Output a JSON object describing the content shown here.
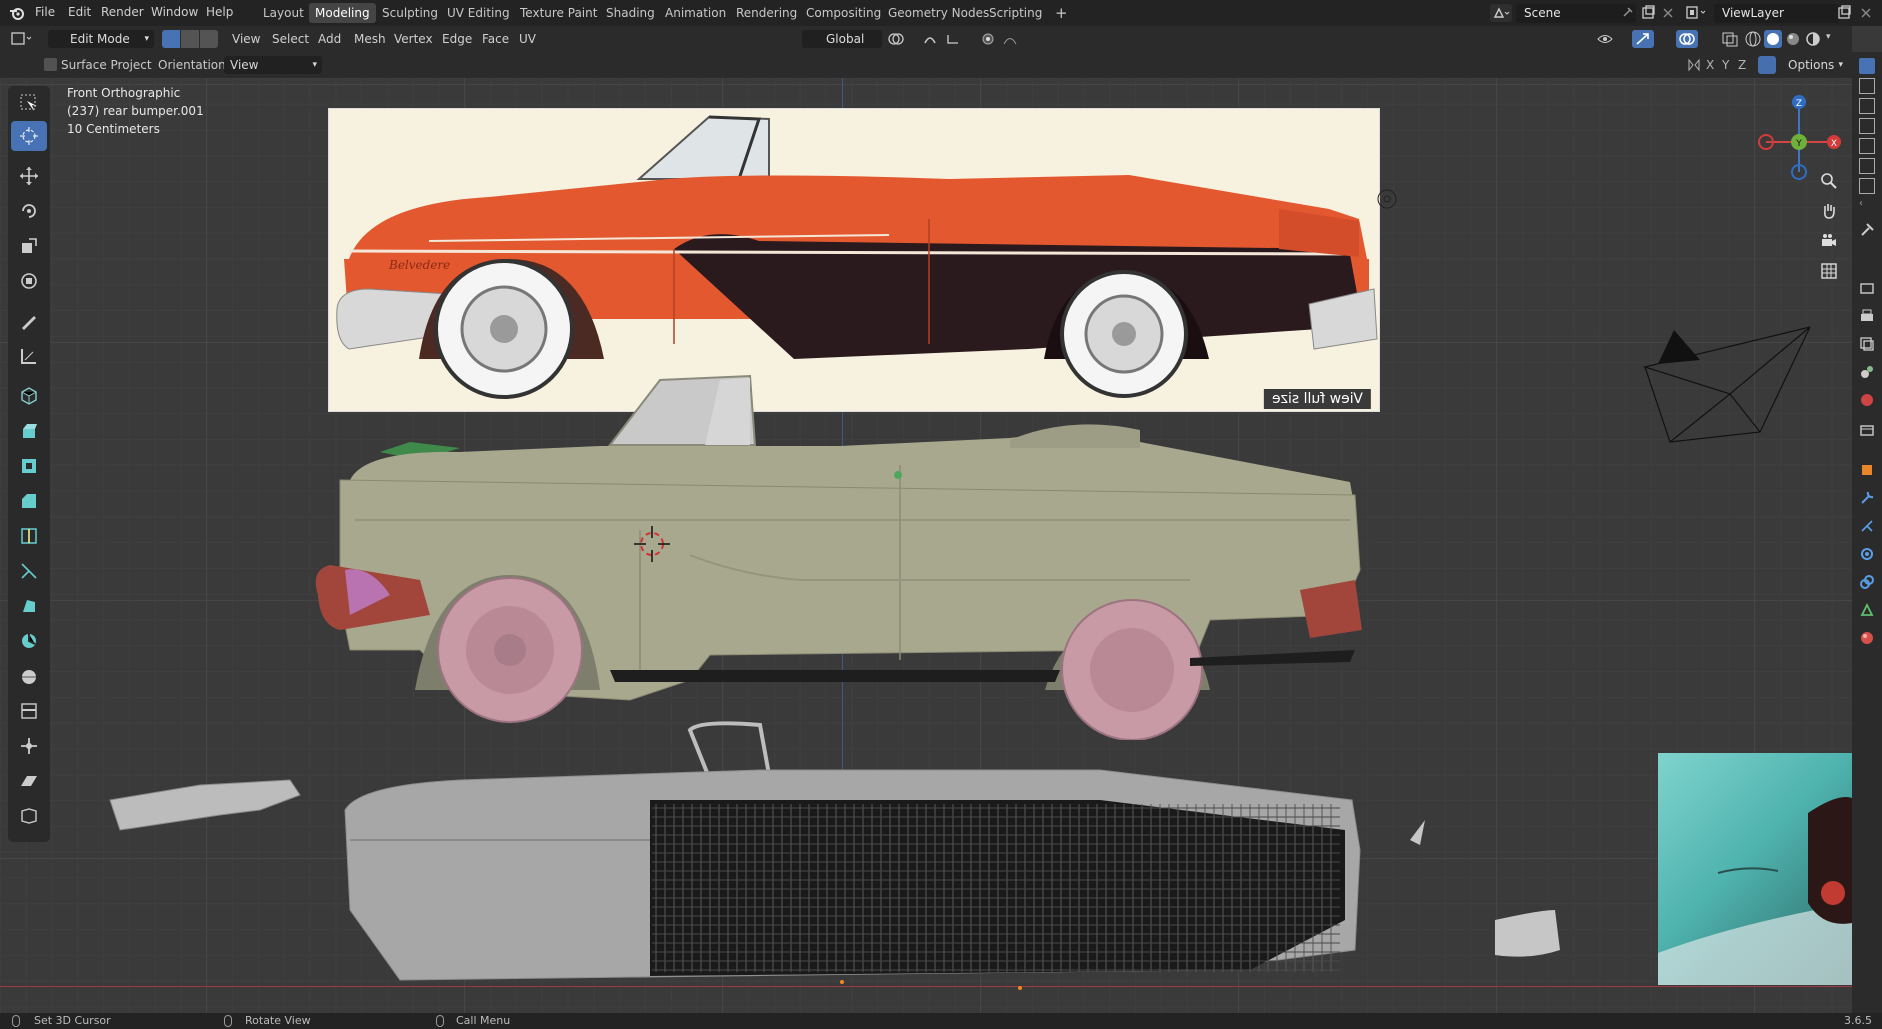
{
  "app": {
    "version": "3.6.5"
  },
  "menu": [
    "File",
    "Edit",
    "Render",
    "Window",
    "Help"
  ],
  "workspaces": [
    {
      "label": "Layout",
      "active": false
    },
    {
      "label": "Modeling",
      "active": true
    },
    {
      "label": "Sculpting",
      "active": false
    },
    {
      "label": "UV Editing",
      "active": false
    },
    {
      "label": "Texture Paint",
      "active": false
    },
    {
      "label": "Shading",
      "active": false
    },
    {
      "label": "Animation",
      "active": false
    },
    {
      "label": "Rendering",
      "active": false
    },
    {
      "label": "Compositing",
      "active": false
    },
    {
      "label": "Geometry Nodes",
      "active": false
    },
    {
      "label": "Scripting",
      "active": false
    }
  ],
  "add_workspace": "+",
  "scene": {
    "label": "Scene"
  },
  "view_layer": {
    "label": "ViewLayer"
  },
  "header": {
    "mode": "Edit Mode",
    "menus": [
      "View",
      "Select",
      "Add",
      "Mesh",
      "Vertex",
      "Edge",
      "Face",
      "UV"
    ],
    "transform_orientation": "Global",
    "axes": [
      "X",
      "Y",
      "Z"
    ],
    "options": "Options"
  },
  "tool_settings": {
    "surface_project": "Surface Project",
    "orientation_label": "Orientation:",
    "orientation_value": "View"
  },
  "viewport_info": {
    "view_name": "Front Orthographic",
    "object_line": "(237)  rear bumper.001",
    "scale": "10 Centimeters"
  },
  "gizmo": {
    "z": "Z",
    "y": "Y",
    "x": "X"
  },
  "reference_image": {
    "caption": "View full size",
    "script_word": "Belvedere"
  },
  "colors": {
    "accent": "#4772b3",
    "car_orange": "#e4582f",
    "car_dark": "#2a1a1e",
    "body_mesh": "#a8a88e",
    "wheels": "#c89aa6",
    "bumpers": "#a2463c",
    "teal_photo": "#4fb3ae"
  },
  "status": {
    "left": "Set 3D Cursor",
    "middle": "Rotate View",
    "right": "Call Menu",
    "version": "3.6.5"
  }
}
